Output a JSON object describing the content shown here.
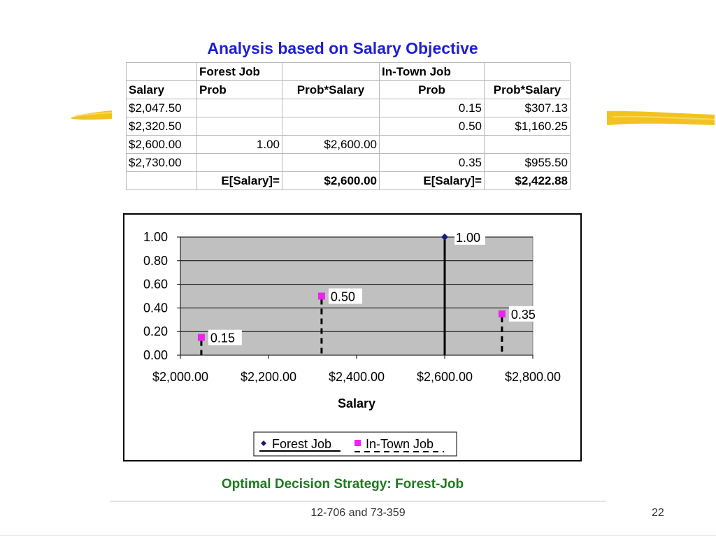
{
  "slide": {
    "title": "Analysis based on Salary Objective",
    "strategy": "Optimal Decision Strategy: Forest-Job",
    "footer": "12-706 and 73-359",
    "page_number": "22"
  },
  "table": {
    "group_headers": [
      "",
      "Forest Job",
      "",
      "In-Town Job",
      ""
    ],
    "columns": [
      "Salary",
      "Prob",
      "Prob*Salary",
      "Prob",
      "Prob*Salary"
    ],
    "rows": [
      [
        "$2,047.50",
        "",
        "",
        "0.15",
        "$307.13"
      ],
      [
        "$2,320.50",
        "",
        "",
        "0.50",
        "$1,160.25"
      ],
      [
        "$2,600.00",
        "1.00",
        "$2,600.00",
        "",
        ""
      ],
      [
        "$2,730.00",
        "",
        "",
        "0.35",
        "$955.50"
      ]
    ],
    "totals": [
      "",
      "E[Salary]=",
      "$2,600.00",
      "E[Salary]=",
      "$2,422.88"
    ]
  },
  "chart_data": {
    "type": "scatter",
    "xlabel": "Salary",
    "ylabel": "",
    "xlim": [
      2000,
      2800
    ],
    "ylim": [
      0,
      1
    ],
    "x_ticks": [
      "$2,000.00",
      "$2,200.00",
      "$2,400.00",
      "$2,600.00",
      "$2,800.00"
    ],
    "y_ticks": [
      "0.00",
      "0.20",
      "0.40",
      "0.60",
      "0.80",
      "1.00"
    ],
    "grid": true,
    "legend_position": "bottom",
    "series": [
      {
        "name": "Forest Job",
        "marker": "diamond",
        "color": "#1a1a7a",
        "points": [
          {
            "x": 2600,
            "y": 1.0,
            "label": "1.00"
          }
        ]
      },
      {
        "name": "In-Town Job",
        "marker": "square",
        "color": "#ee22ee",
        "points": [
          {
            "x": 2047.5,
            "y": 0.15,
            "label": "0.15"
          },
          {
            "x": 2320.5,
            "y": 0.5,
            "label": "0.50"
          },
          {
            "x": 2730,
            "y": 0.35,
            "label": "0.35"
          }
        ]
      }
    ],
    "plot_background": "#c0c0c0"
  }
}
